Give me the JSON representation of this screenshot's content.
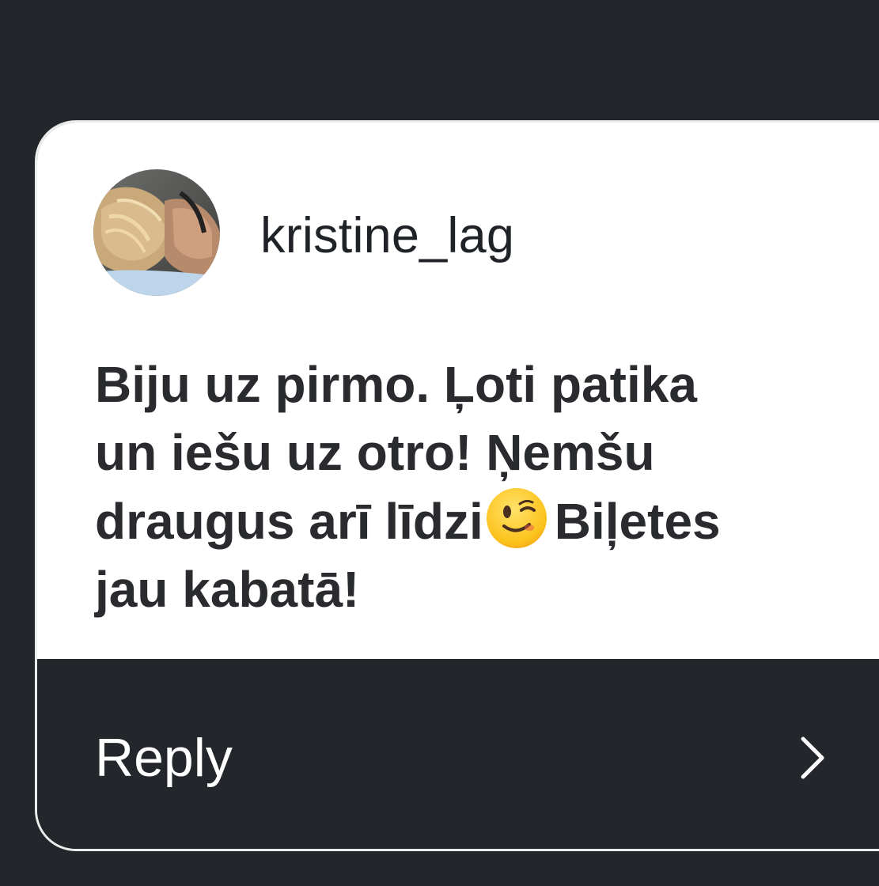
{
  "comment": {
    "username": "kristine_lag",
    "avatar_icon": "profile-photo",
    "message_part1": "Biju uz pirmo. Ļoti patika\nun iešu uz otro! Ņemšu\ndraugus arī līdzi",
    "emoji_icon": "winking-face-emoji",
    "message_part2": "Biļetes\njau kabatā!"
  },
  "reply": {
    "label": "Reply",
    "icon": "chevron-right-icon"
  },
  "colors": {
    "background": "#23262b",
    "card": "#ffffff",
    "border": "#ececec",
    "text": "#2a2b2f"
  }
}
